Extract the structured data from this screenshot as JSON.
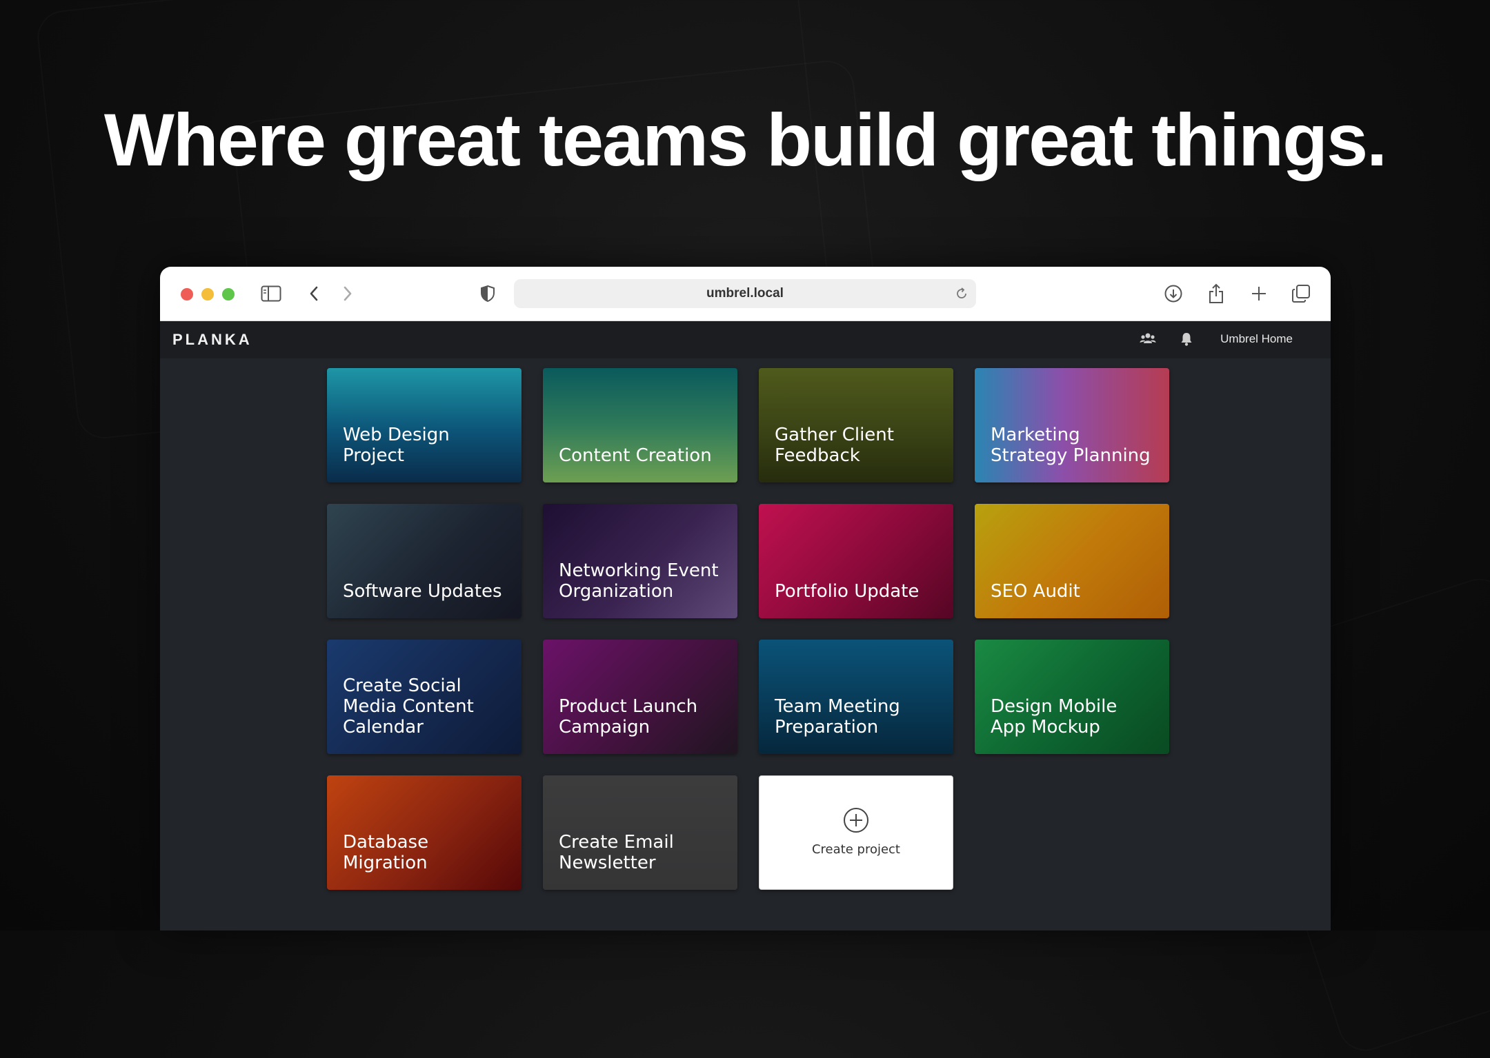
{
  "headline": "Where great teams build great things.",
  "browser": {
    "url": "umbrel.local",
    "icons": [
      "sidebar-icon",
      "back-icon",
      "forward-icon",
      "shield-icon",
      "reload-icon",
      "download-icon",
      "share-icon",
      "new-tab-icon",
      "tabs-overview-icon"
    ]
  },
  "app": {
    "logo": "PLANKA",
    "user_name": "Umbrel Home",
    "icons": [
      "users-icon",
      "bell-icon"
    ]
  },
  "projects": [
    {
      "title": "Web Design Project",
      "gradient": "linear-gradient(180deg, #1e96a6 0%, #0c5478 55%, #0a2c49 100%)"
    },
    {
      "title": "Content Creation",
      "gradient": "linear-gradient(180deg, #0a5a5c 0%, #2f7a5a 50%, #6d9f52 100%)"
    },
    {
      "title": "Gather Client Feedback",
      "gradient": "linear-gradient(180deg, #4f5a1c 0%, #3a4315 55%, #262c0d 100%)"
    },
    {
      "title": "Marketing Strategy Planning",
      "gradient": "linear-gradient(90deg, #2a85b2 0%, #8c4faa 45%, #b63c52 100%)"
    },
    {
      "title": "Software Updates",
      "gradient": "linear-gradient(135deg, #2f4450 0%, #1d2431 55%, #141722 100%)"
    },
    {
      "title": "Networking Event Organization",
      "gradient": "linear-gradient(135deg, #1e0f33 0%, #3a2350 55%, #5e4a78 100%)"
    },
    {
      "title": "Portfolio Update",
      "gradient": "linear-gradient(135deg, #c0114f 0%, #8a0a3a 55%, #560624 100%)"
    },
    {
      "title": "SEO Audit",
      "gradient": "linear-gradient(135deg, #b8a10f 0%, #c17a0a 50%, #b05f06 100%)"
    },
    {
      "title": "Create Social Media Content Calendar",
      "gradient": "linear-gradient(135deg, #1a3a6e 0%, #14284f 55%, #0e1b38 100%)"
    },
    {
      "title": "Product Launch Campaign",
      "gradient": "linear-gradient(135deg, #6b1268 0%, #44123f 55%, #1f1520 100%)"
    },
    {
      "title": "Team Meeting Preparation",
      "gradient": "linear-gradient(180deg, #0b5378 0%, #083b58 55%, #06273c 100%)"
    },
    {
      "title": "Design Mobile App Mockup",
      "gradient": "linear-gradient(135deg, #1a8a43 0%, #0d6530 55%, #0a4a22 100%)"
    },
    {
      "title": "Database Migration",
      "gradient": "linear-gradient(135deg, #bf4310 0%, #8a2410 55%, #550808 100%)"
    },
    {
      "title": "Create Email Newsletter",
      "gradient": "linear-gradient(180deg, #3c3c3d 0%, #353536 100%)"
    }
  ],
  "create_project": {
    "label": "Create project",
    "icon": "plus-circle-icon"
  }
}
